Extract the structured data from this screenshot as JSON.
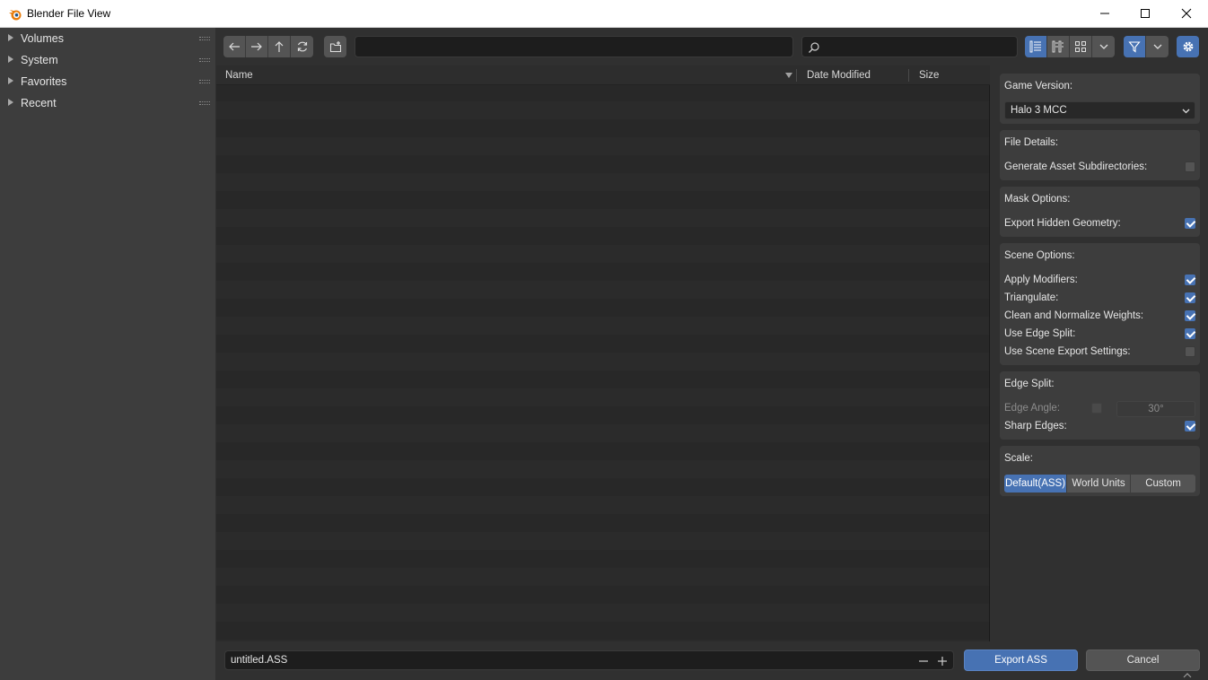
{
  "window": {
    "title": "Blender File View"
  },
  "sidebar": {
    "items": [
      {
        "label": "Volumes"
      },
      {
        "label": "System"
      },
      {
        "label": "Favorites"
      },
      {
        "label": "Recent"
      }
    ]
  },
  "toolbar": {
    "path_value": "",
    "search_value": ""
  },
  "file_list": {
    "columns": [
      "Name",
      "Date Modified",
      "Size"
    ],
    "sort_column": "Name"
  },
  "options": {
    "game_version": {
      "title": "Game Version:",
      "selected": "Halo 3 MCC"
    },
    "file_details": {
      "title": "File Details:",
      "generate_subdirs_label": "Generate Asset Subdirectories:",
      "generate_subdirs_checked": false
    },
    "mask_options": {
      "title": "Mask Options:",
      "export_hidden_label": "Export Hidden Geometry:",
      "export_hidden_checked": true
    },
    "scene_options": {
      "title": "Scene Options:",
      "items": [
        {
          "label": "Apply Modifiers:",
          "checked": true
        },
        {
          "label": "Triangulate:",
          "checked": true
        },
        {
          "label": "Clean and Normalize Weights:",
          "checked": true
        },
        {
          "label": "Use Edge Split:",
          "checked": true
        },
        {
          "label": "Use Scene Export Settings:",
          "checked": false
        }
      ]
    },
    "edge_split": {
      "title": "Edge Split:",
      "edge_angle_label": "Edge Angle:",
      "edge_angle_checked": false,
      "edge_angle_value": "30°",
      "sharp_edges_label": "Sharp Edges:",
      "sharp_edges_checked": true
    },
    "scale": {
      "title": "Scale:",
      "options": [
        "Default(ASS)",
        "World Units",
        "Custom"
      ],
      "selected": "Default(ASS)"
    }
  },
  "bottom": {
    "filename": "untitled.ASS",
    "export_label": "Export ASS",
    "cancel_label": "Cancel"
  },
  "colors": {
    "accent": "#4772b3",
    "panel_bg": "#3d3d3d",
    "window_bg": "#303030",
    "field_bg": "#1d1d1d"
  }
}
